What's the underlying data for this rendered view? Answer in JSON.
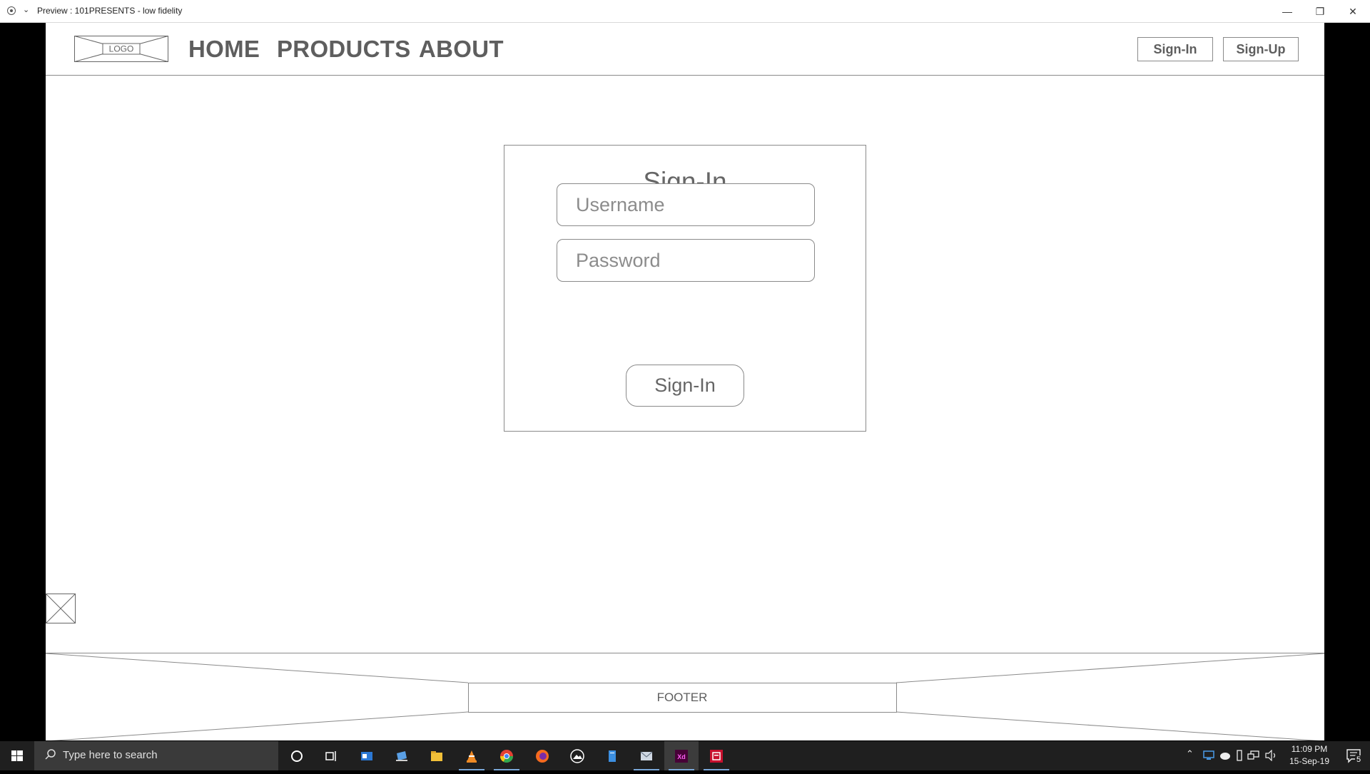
{
  "window": {
    "title": "Preview : 101PRESENTS - low fidelity",
    "controls": [
      "minimize",
      "restore",
      "close"
    ]
  },
  "nav": {
    "logo_text": "LOGO",
    "links": [
      "HOME",
      "PRODUCTS",
      "ABOUT"
    ],
    "buttons": {
      "signin": "Sign-In",
      "signup": "Sign-Up"
    }
  },
  "signin_form": {
    "title": "Sign-In",
    "username_placeholder": "Username",
    "password_placeholder": "Password",
    "submit_label": "Sign-In"
  },
  "footer": {
    "label": "FOOTER"
  },
  "taskbar": {
    "search_placeholder": "Type here to search",
    "apps": [
      "cortana",
      "task-view",
      "outlook",
      "edge-like",
      "file-explorer",
      "vlc",
      "chrome",
      "firefox",
      "photos",
      "word-like",
      "mail",
      "adobe-xd",
      "presenter"
    ],
    "clock_time": "11:09 PM",
    "clock_date": "15-Sep-19",
    "notifications_count": "5"
  }
}
